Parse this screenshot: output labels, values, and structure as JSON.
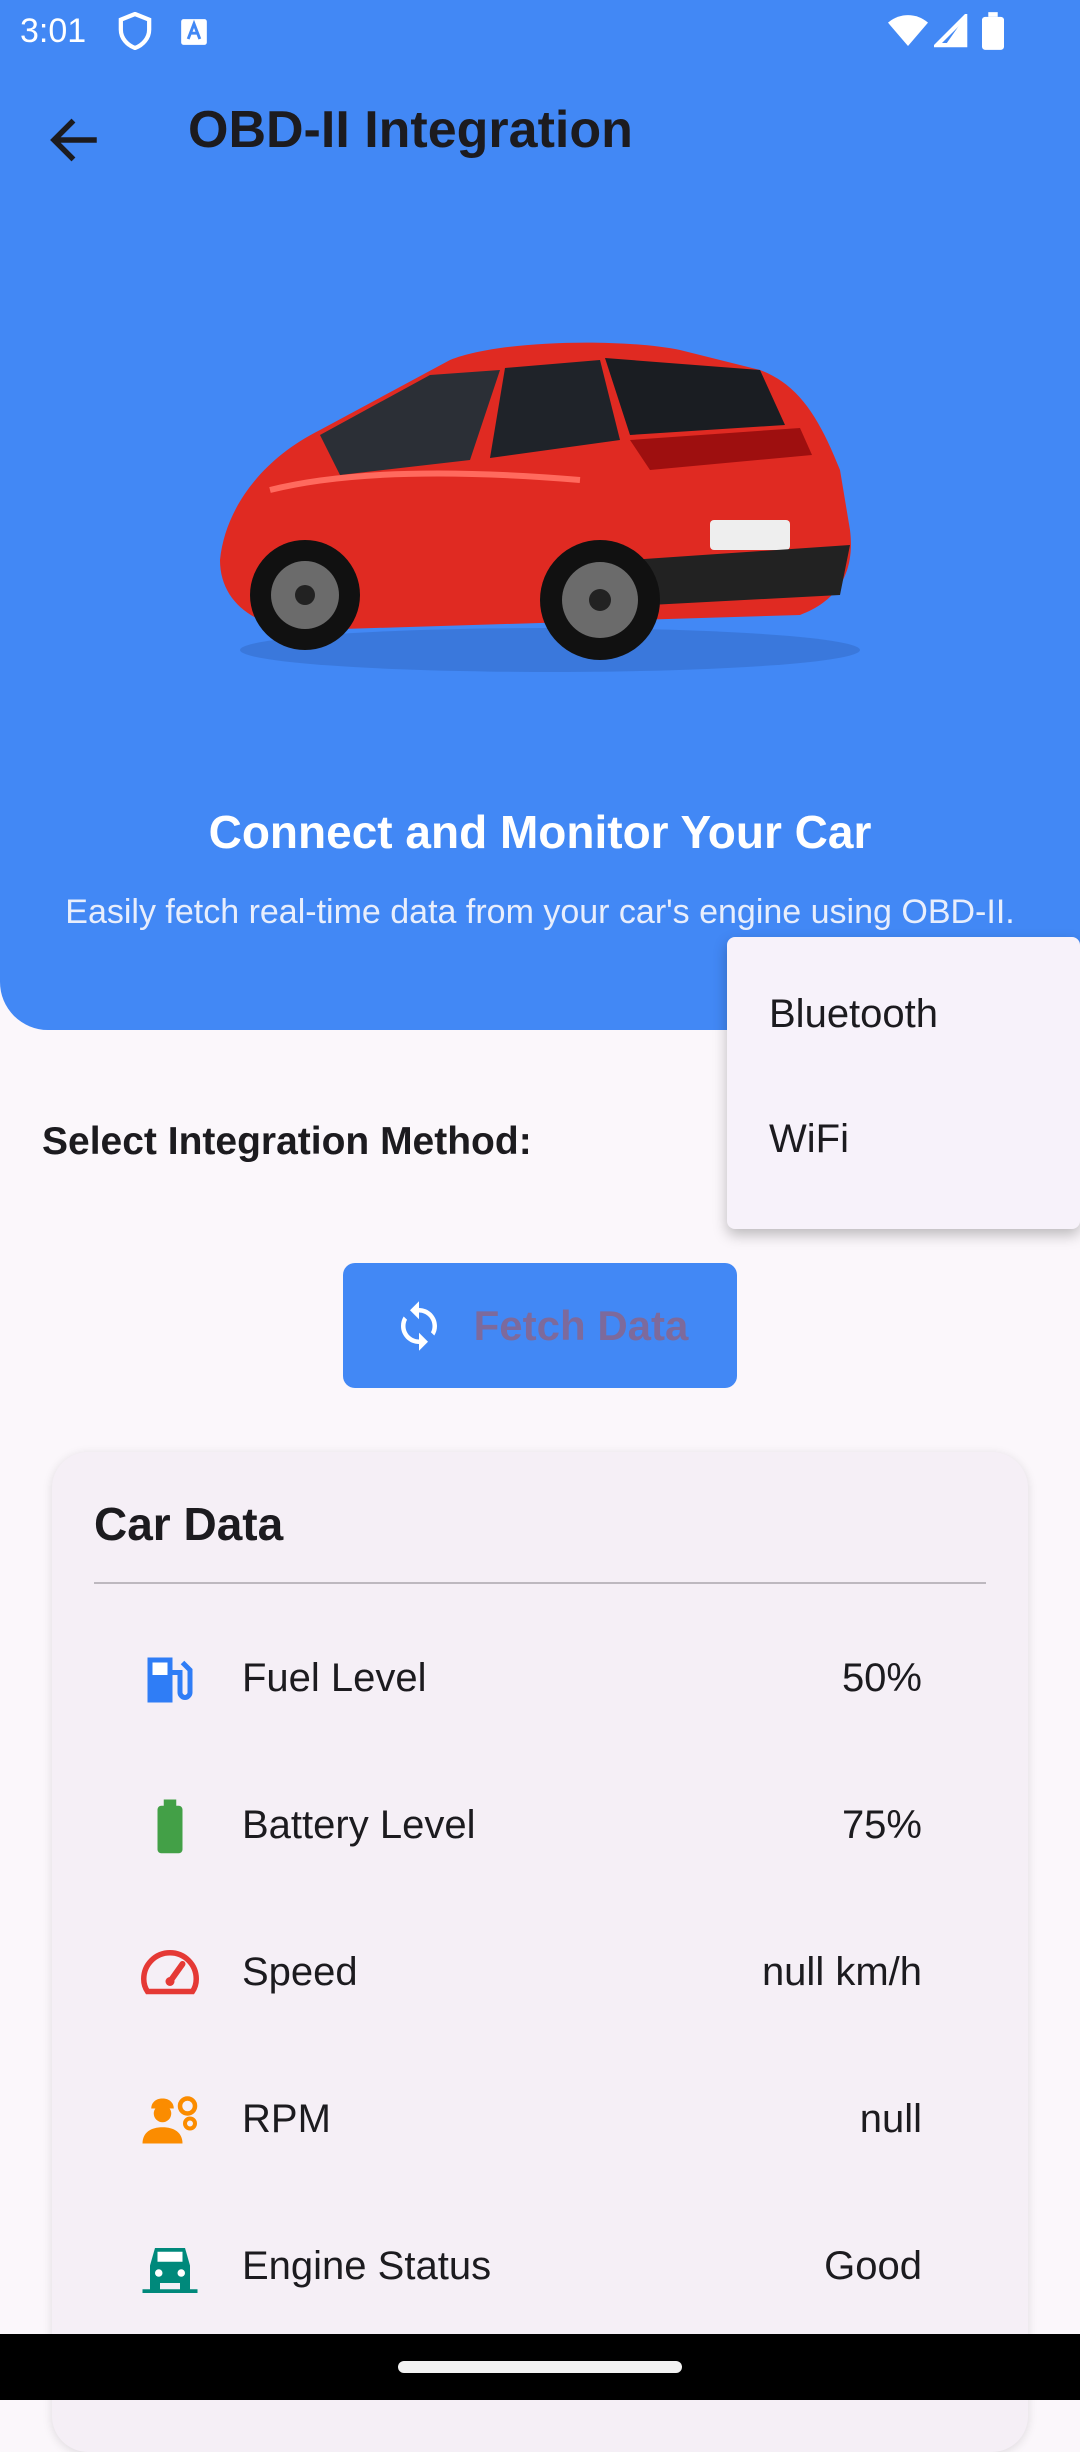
{
  "status_bar": {
    "time": "3:01",
    "icons": [
      "shield-icon",
      "a-box-icon",
      "wifi-icon",
      "signal-icon",
      "battery-icon"
    ]
  },
  "app_bar": {
    "title": "OBD-II Integration",
    "back_icon": "arrow-left-icon"
  },
  "hero": {
    "image": "red-hatchback-car",
    "title": "Connect and Monitor Your Car",
    "subtitle": "Easily fetch real-time data from your car's engine using OBD-II."
  },
  "integration": {
    "label": "Select Integration Method:",
    "options": [
      "Bluetooth",
      "WiFi"
    ]
  },
  "fetch_button": {
    "label": "Fetch Data",
    "icon": "sync-icon"
  },
  "car_data": {
    "title": "Car Data",
    "rows": [
      {
        "label": "Fuel Level",
        "value": "50%",
        "icon": "fuel-pump-icon",
        "color": "#2f7df6"
      },
      {
        "label": "Battery Level",
        "value": "75%",
        "icon": "battery-full-icon",
        "color": "#43a047"
      },
      {
        "label": "Speed",
        "value": "null km/h",
        "icon": "speedometer-icon",
        "color": "#e53935"
      },
      {
        "label": "RPM",
        "value": "null",
        "icon": "engineer-icon",
        "color": "#fb8c00"
      },
      {
        "label": "Engine Status",
        "value": "Good",
        "icon": "car-front-icon",
        "color": "#00897b"
      }
    ]
  },
  "colors": {
    "primary": "#4288f5",
    "background": "#fbf7fb",
    "card": "#f5eff6"
  }
}
